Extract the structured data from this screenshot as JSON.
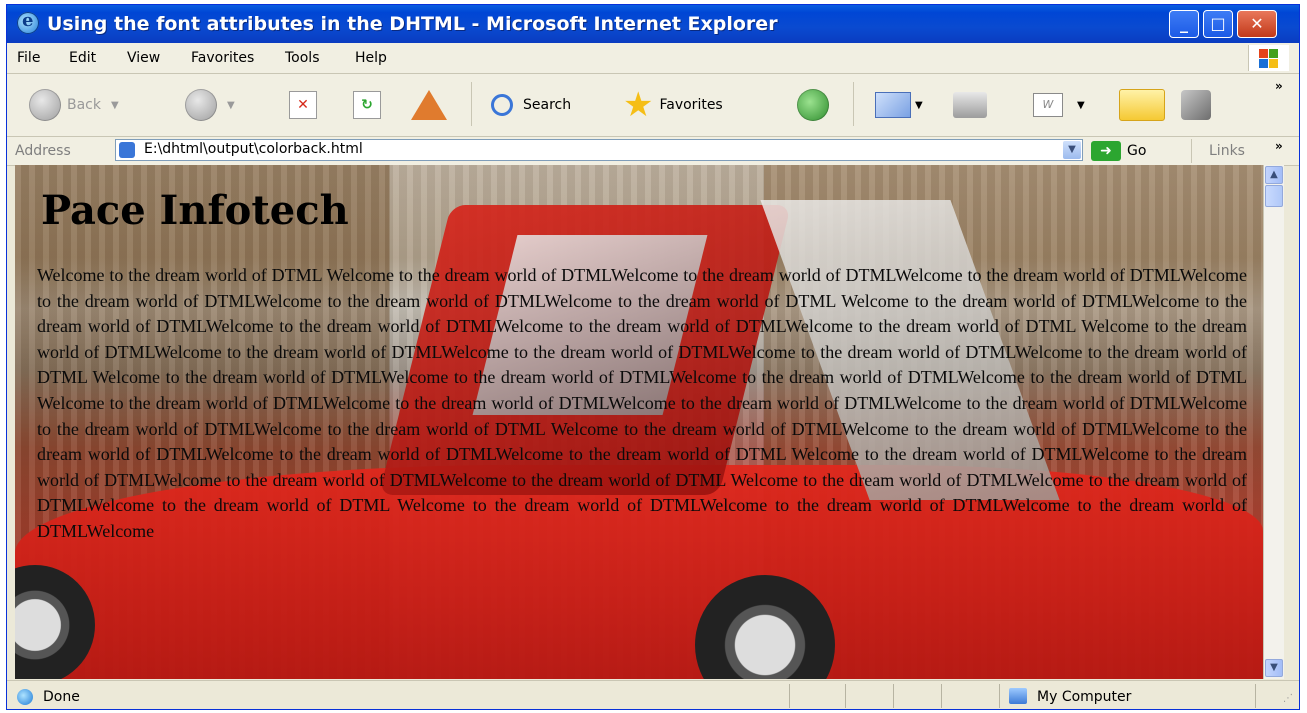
{
  "window": {
    "title": "Using the font attributes in the DHTML - Microsoft Internet Explorer",
    "controls": {
      "minimize": "_",
      "maximize": "□",
      "close": "✕"
    }
  },
  "menubar": {
    "items": [
      "File",
      "Edit",
      "View",
      "Favorites",
      "Tools",
      "Help"
    ]
  },
  "toolbar": {
    "back_label": "Back",
    "search_label": "Search",
    "favorites_label": "Favorites"
  },
  "address": {
    "label": "Address",
    "url": "E:\\dhtml\\output\\colorback.html",
    "go_label": "Go",
    "links_label": "Links"
  },
  "page": {
    "heading": "Pace Infotech",
    "body": "Welcome to the dream world of DTML Welcome to the dream world of DTMLWelcome to the dream world of DTMLWelcome to the dream world of DTMLWelcome to the dream world of DTMLWelcome to the dream world of DTMLWelcome to the dream world of DTML Welcome to the dream world of DTMLWelcome to the dream world of DTMLWelcome to the dream world of DTMLWelcome to the dream world of DTMLWelcome to the dream world of DTML Welcome to the dream world of DTMLWelcome to the dream world of DTMLWelcome to the dream world of DTMLWelcome to the dream world of DTMLWelcome to the dream world of DTML Welcome to the dream world of DTMLWelcome to the dream world of DTMLWelcome to the dream world of DTMLWelcome to the dream world of DTML Welcome to the dream world of DTMLWelcome to the dream world of DTMLWelcome to the dream world of DTMLWelcome to the dream world of DTMLWelcome to the dream world of DTMLWelcome to the dream world of DTML Welcome to the dream world of DTMLWelcome to the dream world of DTMLWelcome to the dream world of DTMLWelcome to the dream world of DTMLWelcome to the dream world of DTML Welcome to the dream world of DTMLWelcome to the dream world of DTMLWelcome to the dream world of DTMLWelcome to the dream world of DTML Welcome to the dream world of DTMLWelcome to the dream world of DTMLWelcome to the dream world of DTML Welcome to the dream world of DTMLWelcome to the dream world of DTMLWelcome to the dream world of DTMLWelcome"
  },
  "status": {
    "text": "Done",
    "zone": "My Computer"
  }
}
